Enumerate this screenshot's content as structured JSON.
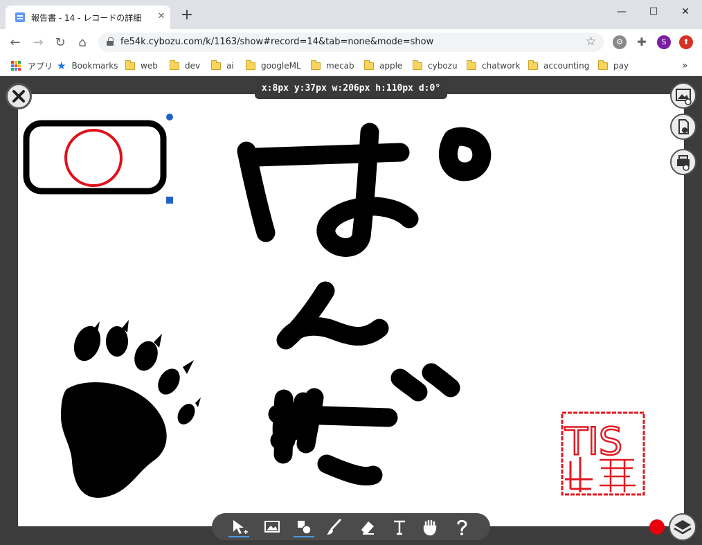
{
  "browser": {
    "tab_title": "報告書 - 14 - レコードの詳細",
    "tab_close": "✕",
    "new_tab": "+",
    "window_controls": {
      "minimize": "—",
      "maximize": "☐",
      "close": "✕"
    },
    "url": "fe54k.cybozu.com/k/1163/show#record=14&tab=none&mode=show",
    "profile_initial": "S",
    "bookmarks": {
      "apps_label": "アプリ",
      "items": [
        "Bookmarks",
        "web",
        "dev",
        "ai",
        "googleML",
        "mecab",
        "apple",
        "cybozu",
        "chatwork",
        "accounting",
        "pay"
      ],
      "overflow": "»"
    }
  },
  "editor": {
    "selection_info": "x:8px  y:37px  w:206px  h:110px  d:0°",
    "stamp_text": "TIS",
    "accent_color": "#e8000c",
    "selection_handle_color": "#1f63c4",
    "tools": [
      "select-tool",
      "image-tool",
      "shape-tool",
      "brush-tool",
      "eraser-tool",
      "text-tool",
      "hand-tool",
      "help-tool"
    ]
  }
}
